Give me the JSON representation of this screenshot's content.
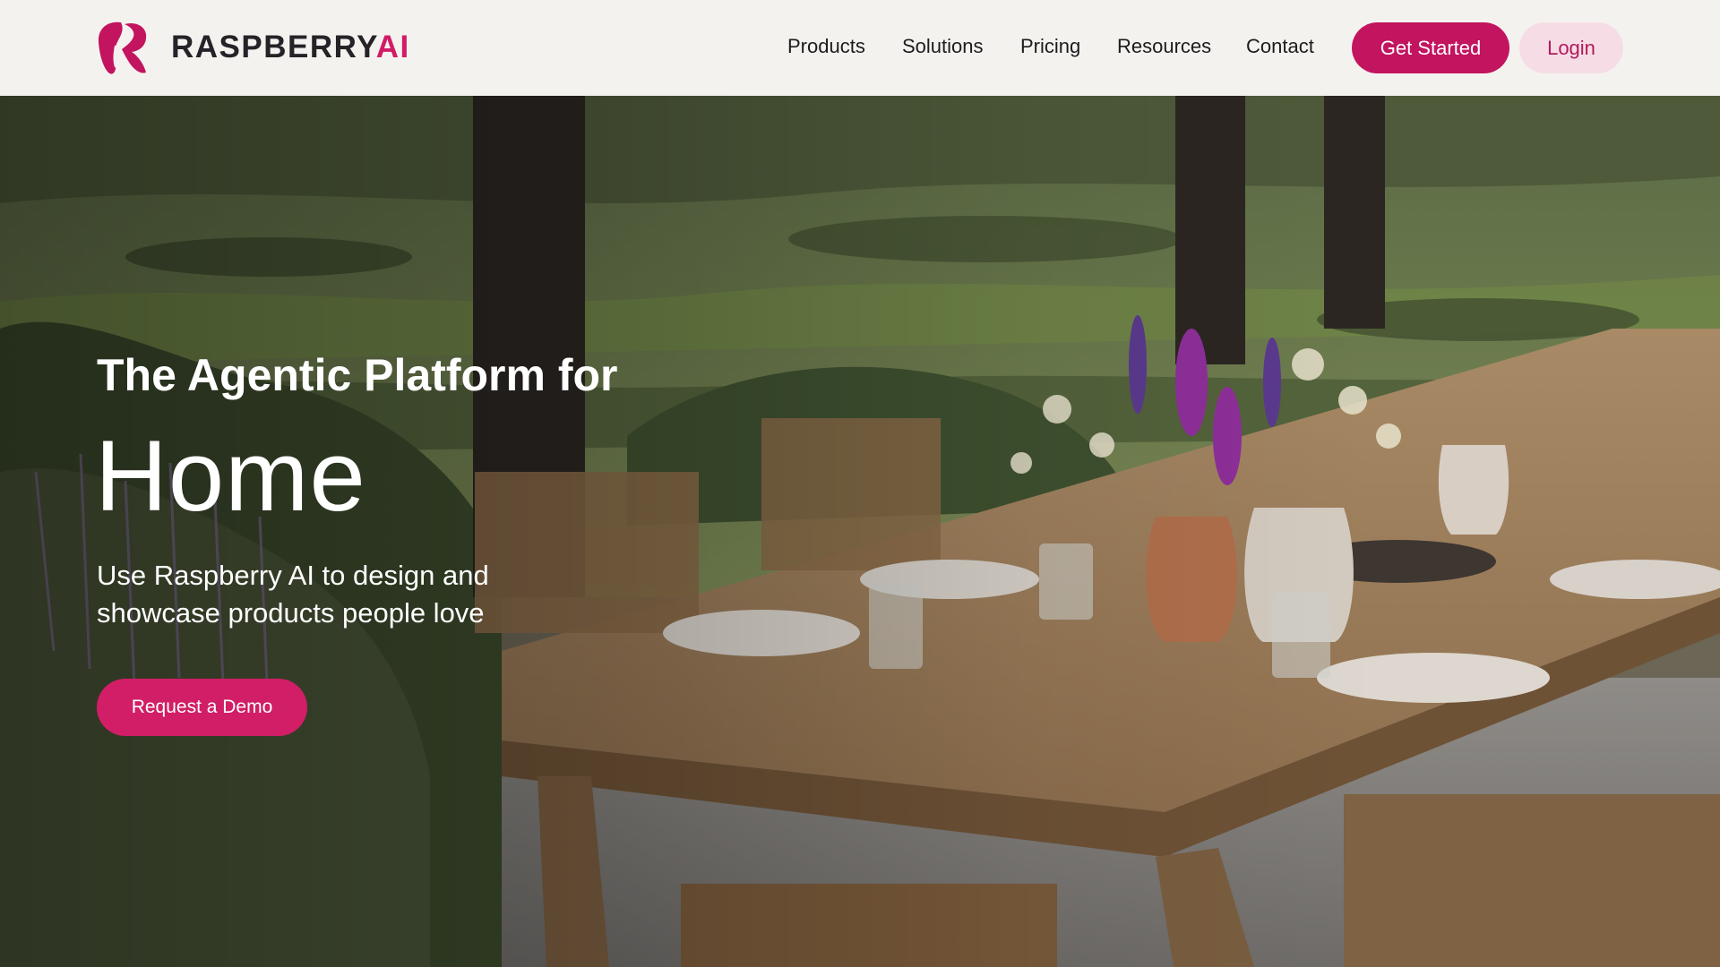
{
  "brand": {
    "name_main": "RASPBERRY",
    "name_accent": "AI",
    "accent_color": "#c2145f",
    "logo_icon": "raspberry-logo-icon"
  },
  "nav": {
    "items": [
      {
        "label": "Products"
      },
      {
        "label": "Solutions"
      },
      {
        "label": "Pricing"
      },
      {
        "label": "Resources"
      },
      {
        "label": "Contact"
      }
    ],
    "get_started_label": "Get Started",
    "login_label": "Login"
  },
  "hero": {
    "eyebrow": "The Agentic Platform for",
    "headline": "Home",
    "subtitle_line1": "Use Raspberry AI to design and",
    "subtitle_line2": "showcase products people love",
    "cta_label": "Request a Demo",
    "background": "outdoor-dining-table-photo"
  }
}
